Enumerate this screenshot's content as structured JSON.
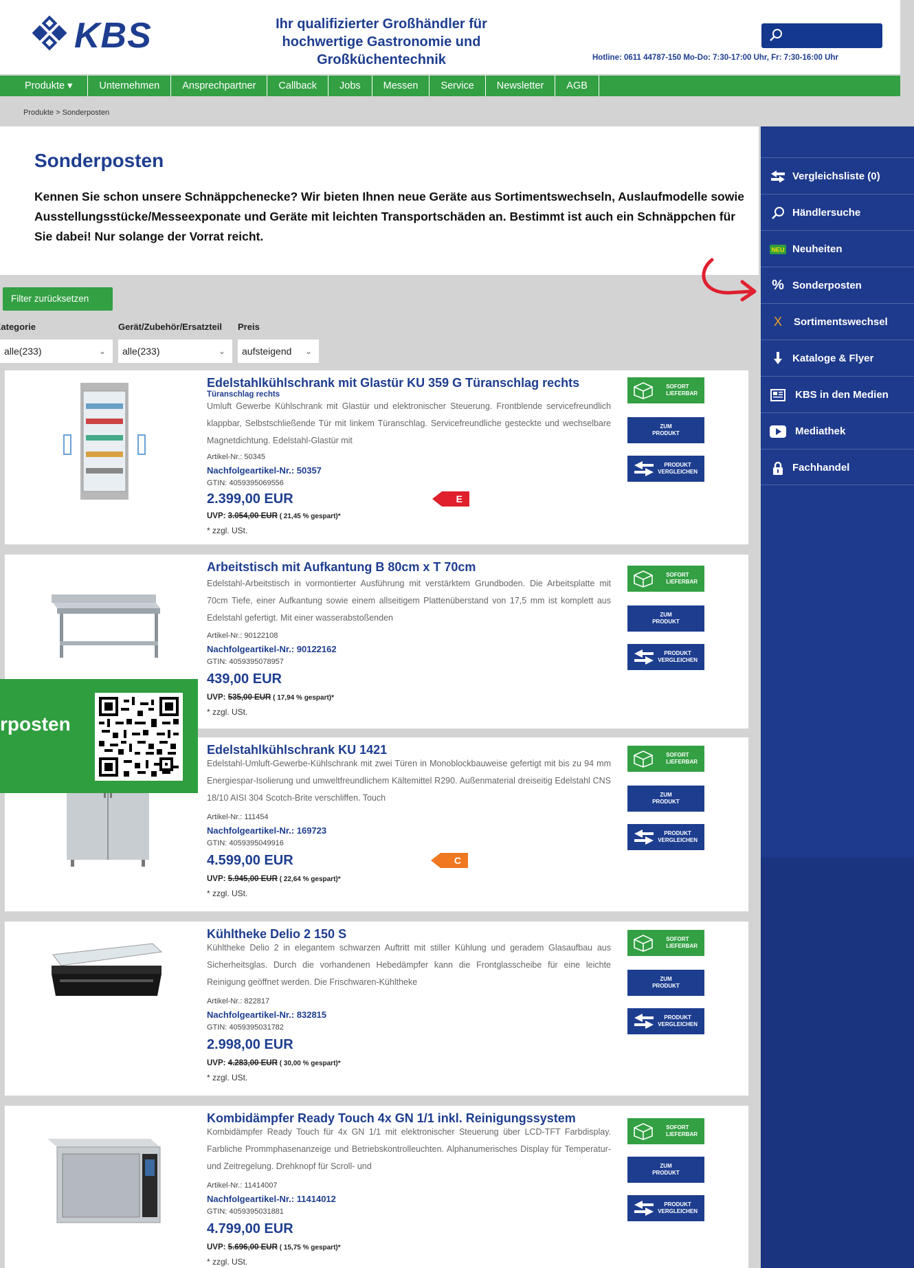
{
  "header": {
    "logo_text": "KBS",
    "tagline": "Ihr qualifizierter Großhändler für hochwertige Gastronomie und Großküchentechnik",
    "hotline": "Hotline: 0611 44787-150 Mo-Do: 7:30-17:00 Uhr, Fr: 7:30-16:00 Uhr",
    "search_icon": "search-icon"
  },
  "nav": [
    "Produkte ▾",
    "Unternehmen",
    "Ansprechpartner",
    "Callback",
    "Jobs",
    "Messen",
    "Service",
    "Newsletter",
    "AGB"
  ],
  "breadcrumb": "Produkte   > Sonderposten",
  "page": {
    "title": "Sonderposten",
    "intro": "Kennen Sie schon unsere Schnäppchenecke? Wir bieten Ihnen neue Geräte aus Sortimentswechseln, Auslaufmodelle sowie Ausstellungsstücke/Messeexponate und Geräte mit leichten Transportschäden an. Bestimmt ist auch ein Schnäppchen für Sie dabei! Nur solange der Vorrat reicht."
  },
  "filters": {
    "reset_label": "Filter zurücksetzen",
    "kategorie_label": "Kategorie",
    "geraet_label": "Gerät/Zubehör/Ersatzteil",
    "preis_label": "Preis",
    "kategorie_value": "alle(233)",
    "geraet_value": "alle(233)",
    "preis_value": "aufsteigend"
  },
  "badges": {
    "sofort": "SOFORT\nLIEFERBAR",
    "zum_produkt": "ZUM\nPRODUKT",
    "vergleichen": "PRODUKT\nVERGLEICHEN"
  },
  "products": [
    {
      "title": "Edelstahlkühlschrank mit Glastür KU 359 G Türanschlag rechts",
      "subtitle": "Türanschlag rechts",
      "desc": "Umluft Gewerbe Kühlschrank mit Glastür und elektronischer Steuerung. Frontblende servicefreundlich klappbar, Selbstschließende Tür mit linkem Türanschlag. Servicefreundliche gesteckte und wechselbare Magnetdichtung. Edelstahl-Glastür mit",
      "artikel": "Artikel-Nr.: 50345",
      "nachfolger": "Nachfolgeartikel-Nr.: 50357",
      "gtin": "GTIN: 4059395069556",
      "price": "2.399,00 EUR",
      "uvp_prefix": "UVP: ",
      "uvp_old": "3.054,00 EUR",
      "uvp_pct": " ( 21,45 % gespart)*",
      "zzgl": "* zzgl. USt.",
      "energy": "E",
      "energy_color": "#e0202c"
    },
    {
      "title": "Arbeitstisch mit Aufkantung B 80cm x T 70cm",
      "subtitle": "",
      "desc": "Edelstahl-Arbeitstisch in vormontierter Ausführung mit verstärktem Grundboden. Die Arbeitsplatte mit 70cm Tiefe, einer Aufkantung sowie einem allseitigem Plattenüberstand von 17,5 mm ist komplett aus Edelstahl gefertigt. Mit einer wasserabstoßenden",
      "artikel": "Artikel-Nr.: 90122108",
      "nachfolger": "Nachfolgeartikel-Nr.: 90122162",
      "gtin": "GTIN: 4059395078957",
      "price": "439,00 EUR",
      "uvp_prefix": "UVP: ",
      "uvp_old": "535,00 EUR",
      "uvp_pct": " ( 17,94 % gespart)*",
      "zzgl": "* zzgl. USt.",
      "energy": "",
      "energy_color": ""
    },
    {
      "title": "Edelstahlkühlschrank KU 1421",
      "subtitle": "",
      "desc": "Edelstahl-Umluft-Gewerbe-Kühlschrank mit zwei Türen in Monoblockbauweise gefertigt mit bis zu 94 mm Energiespar-Isolierung und umweltfreundlichem Kältemittel R290. Außenmaterial dreiseitig Edelstahl CNS 18/10 AISI 304 Scotch-Brite verschliffen. Touch",
      "artikel": "Artikel-Nr.: 111454",
      "nachfolger": "Nachfolgeartikel-Nr.: 169723",
      "gtin": "GTIN: 4059395049916",
      "price": "4.599,00 EUR",
      "uvp_prefix": "UVP: ",
      "uvp_old": "5.945,00 EUR",
      "uvp_pct": " ( 22,64 % gespart)*",
      "zzgl": "* zzgl. USt.",
      "energy": "C",
      "energy_color": "#f07820"
    },
    {
      "title": "Kühltheke Delio 2 150 S",
      "subtitle": "",
      "desc": "Kühltheke Delio 2 in elegantem schwarzen Auftritt mit stiller Kühlung und geradem Glasaufbau aus Sicherheitsglas. Durch die vorhandenen Hebedämpfer kann die Frontglasscheibe für eine leichte Reinigung geöffnet werden. Die Frischwaren-Kühltheke",
      "artikel": "Artikel-Nr.: 822817",
      "nachfolger": "Nachfolgeartikel-Nr.: 832815",
      "gtin": "GTIN: 4059395031782",
      "price": "2.998,00 EUR",
      "uvp_prefix": "UVP: ",
      "uvp_old": "4.283,00 EUR",
      "uvp_pct": " ( 30,00 % gespart)*",
      "zzgl": "* zzgl. USt.",
      "energy": "",
      "energy_color": ""
    },
    {
      "title": "Kombidämpfer Ready Touch 4x GN 1/1 inkl. Reinigungssystem",
      "subtitle": "",
      "desc": "Kombidämpfer Ready Touch für 4x GN 1/1 mit elektronischer Steuerung über LCD-TFT Farbdisplay. Farbliche Prommphasenanzeige und Betriebskontrolleuchten. Alphanumerisches Display für Temperatur- und Zeitregelung. Drehknopf für Scroll- und",
      "artikel": "Artikel-Nr.: 11414007",
      "nachfolger": "Nachfolgeartikel-Nr.: 11414012",
      "gtin": "GTIN: 4059395031881",
      "price": "4.799,00 EUR",
      "uvp_prefix": "UVP: ",
      "uvp_old": "5.696,00 EUR",
      "uvp_pct": " ( 15,75 % gespart)*",
      "zzgl": "* zzgl. USt.",
      "energy": "",
      "energy_color": ""
    }
  ],
  "sidebar": [
    {
      "label": "Vergleichsliste (0)",
      "icon": "compare-arrows-icon"
    },
    {
      "label": "Händlersuche",
      "icon": "search-icon"
    },
    {
      "label": "Neuheiten",
      "icon": "new-badge-icon"
    },
    {
      "label": "Sonderposten",
      "icon": "percent-icon"
    },
    {
      "label": "Sortimentswechsel",
      "icon": "x-icon"
    },
    {
      "label": "Kataloge & Flyer",
      "icon": "download-icon"
    },
    {
      "label": "KBS in den Medien",
      "icon": "newspaper-icon"
    },
    {
      "label": "Mediathek",
      "icon": "play-icon"
    },
    {
      "label": "Fachhandel",
      "icon": "lock-icon"
    }
  ],
  "promo": {
    "text": "rposten"
  },
  "colors": {
    "brand_blue": "#1d3d8f",
    "brand_green": "#33a043",
    "sidebar_blue": "#1e3a8c"
  }
}
